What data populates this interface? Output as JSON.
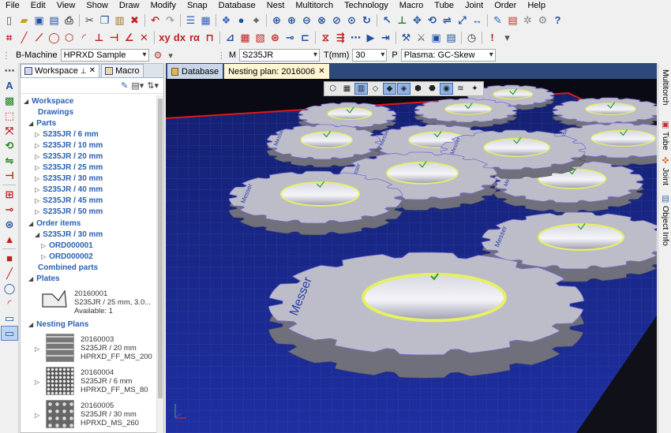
{
  "menu": [
    "File",
    "Edit",
    "View",
    "Show",
    "Draw",
    "Modify",
    "Snap",
    "Database",
    "Nest",
    "Multitorch",
    "Technology",
    "Macro",
    "Tube",
    "Joint",
    "Order",
    "Help"
  ],
  "machine_bar": {
    "machine_label": "B-Machine",
    "machine_value": "HPRXD Sample",
    "material_label": "M",
    "material_value": "S235JR",
    "thickness_label": "T(mm)",
    "thickness_value": "30",
    "process_label": "P",
    "process_value": "Plasma: GC-Skew"
  },
  "panel_tabs": [
    "Workspace",
    "Macro"
  ],
  "tree": {
    "workspace": "Workspace",
    "drawings": "Drawings",
    "parts": "Parts",
    "part_items": [
      "S235JR / 6 mm",
      "S235JR / 10 mm",
      "S235JR / 20 mm",
      "S235JR / 25 mm",
      "S235JR / 30 mm",
      "S235JR / 40 mm",
      "S235JR / 45 mm",
      "S235JR / 50 mm"
    ],
    "order_items": "Order items",
    "order_group": "S235JR / 30 mm",
    "orders": [
      "ORD000001",
      "ORD000002"
    ],
    "combined": "Combined parts",
    "plates": "Plates",
    "plate": {
      "id": "20160001",
      "desc": "S235JR / 25 mm, 3.0...",
      "avail": "Available: 1"
    },
    "nesting": "Nesting Plans",
    "plans": [
      {
        "id": "20160003",
        "mat": "S235JR / 20 mm",
        "name": "HPRXD_FF_MS_200"
      },
      {
        "id": "20160004",
        "mat": "S235JR / 6 mm",
        "name": "HPRXD_FF_MS_80"
      },
      {
        "id": "20160005",
        "mat": "S235JR / 30 mm",
        "name": "HPRXD_MS_260"
      }
    ]
  },
  "doc_tabs": {
    "database": "Database",
    "nesting": "Nesting plan: 2016006"
  },
  "right_tabs": [
    "Multitorch",
    "Tube",
    "Joint",
    "Object Info"
  ],
  "view_part_label": "Messer",
  "icons": {
    "pin": "pin-icon",
    "close": "close-icon",
    "part": "gear-part-icon"
  },
  "colors": {
    "sheet": "#1c2a8c",
    "grid": "#3a52c8",
    "border": "#d01010",
    "part": "#b9b9c6",
    "hole": "#e8f060",
    "tab_active": "#fff5d2"
  }
}
